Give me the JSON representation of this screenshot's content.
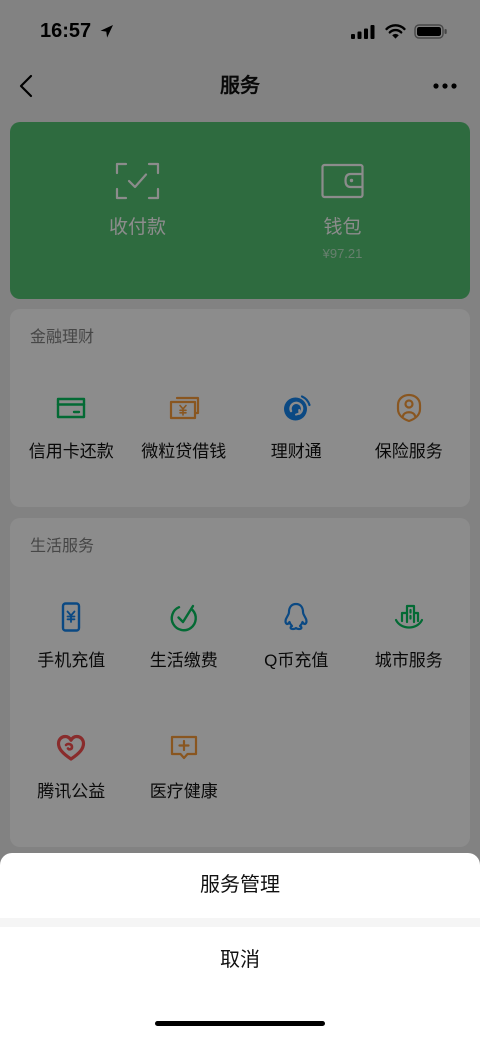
{
  "status_bar": {
    "time": "16:57",
    "icons": [
      "location-arrow-icon",
      "cellular-signal-icon",
      "wifi-icon",
      "battery-icon"
    ]
  },
  "nav": {
    "title": "服务",
    "back_icon": "chevron-left-icon",
    "more_icon": "more-dots-icon"
  },
  "wallet_card": {
    "items": [
      {
        "label": "收付款",
        "icon": "scan-pay-icon"
      },
      {
        "label": "钱包",
        "icon": "wallet-icon",
        "balance": "¥97.21"
      }
    ]
  },
  "sections": [
    {
      "title": "金融理财",
      "items": [
        {
          "label": "信用卡还款",
          "icon": "credit-card-icon"
        },
        {
          "label": "微粒贷借钱",
          "icon": "loan-bills-icon"
        },
        {
          "label": "理财通",
          "icon": "wealth-management-icon"
        },
        {
          "label": "保险服务",
          "icon": "insurance-icon"
        }
      ]
    },
    {
      "title": "生活服务",
      "items": [
        {
          "label": "手机充值",
          "icon": "mobile-topup-icon"
        },
        {
          "label": "生活缴费",
          "icon": "utility-payment-icon"
        },
        {
          "label": "Q币充值",
          "icon": "qq-penguin-icon"
        },
        {
          "label": "城市服务",
          "icon": "city-services-icon"
        },
        {
          "label": "腾讯公益",
          "icon": "charity-heart-icon"
        },
        {
          "label": "医疗健康",
          "icon": "medical-health-icon"
        }
      ]
    }
  ],
  "action_sheet": {
    "items": [
      {
        "label": "服务管理"
      }
    ],
    "cancel_label": "取消"
  },
  "colors": {
    "page_bg": "#ededed",
    "wallet_card": "#55c374",
    "icon_green": "#07c160",
    "icon_orange": "#fa9d3b",
    "icon_blue": "#1485ee",
    "icon_red": "#fa5151",
    "overlay": "rgba(0,0,0,0.45)"
  }
}
